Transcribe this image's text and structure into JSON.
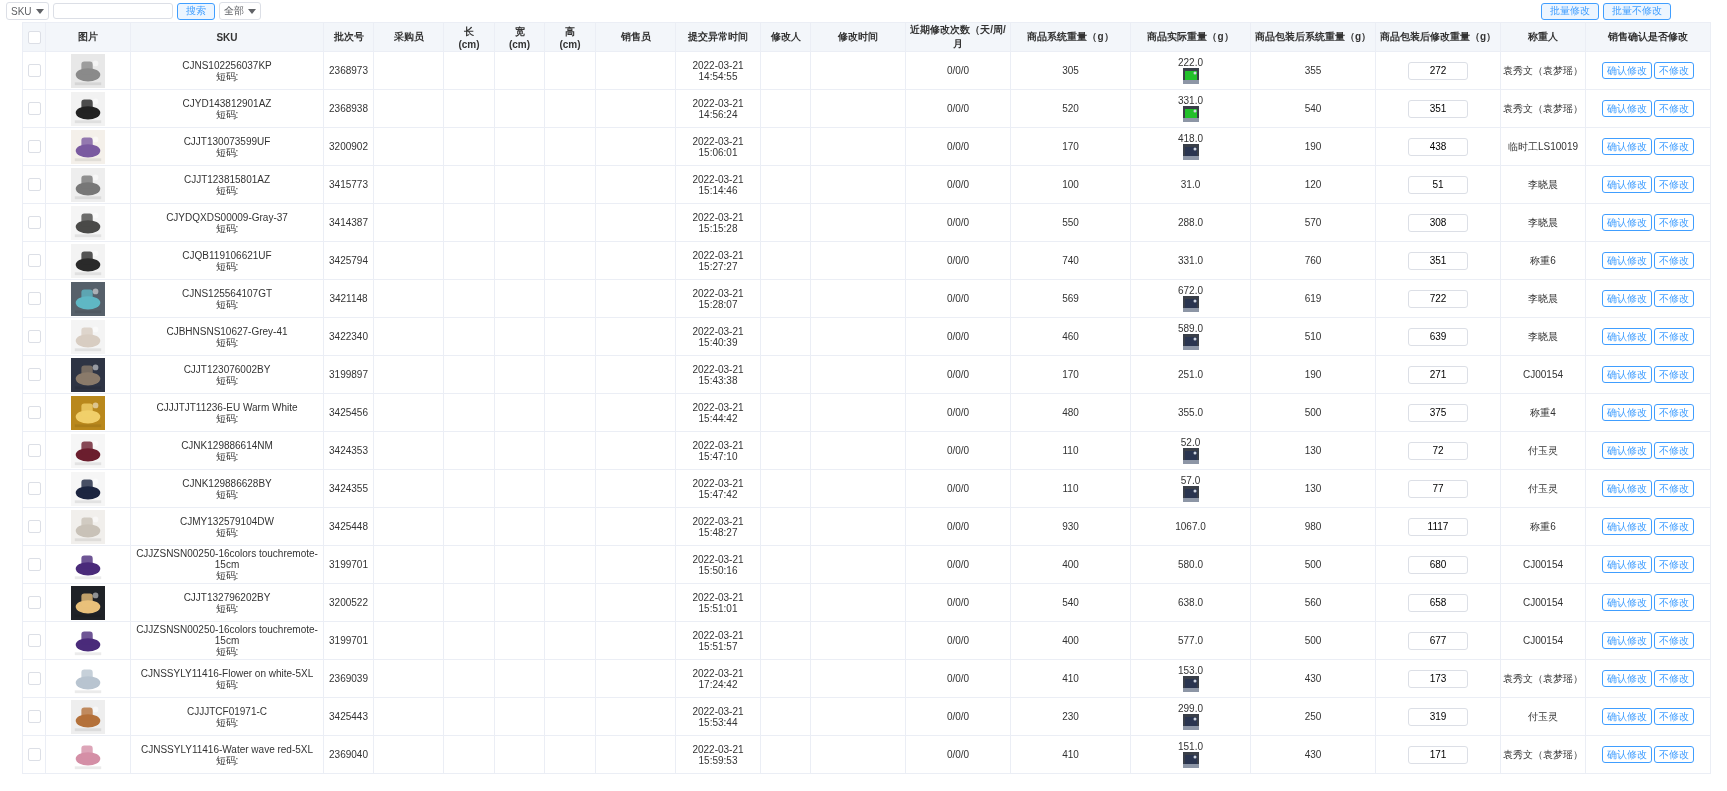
{
  "toolbar": {
    "field_select": "SKU",
    "search_button": "搜索",
    "status_select": "全部",
    "batch_buttons": [
      "批量修改",
      "批量不修改"
    ]
  },
  "table": {
    "select_all": {
      "checked": false
    },
    "columns": [
      "图片",
      "SKU",
      "批次号",
      "采购员",
      "长\n(cm)",
      "宽\n(cm)",
      "高\n(cm)",
      "销售员",
      "提交异常时间",
      "修改人",
      "修改时间",
      "近期修改次数（天/周/月",
      "商品系统重量（g）",
      "商品实际重量（g）",
      "商品包装后系统重量（g）",
      "商品包装后修改重量（g）",
      "称重人",
      "销售确认是否修改"
    ],
    "rows": [
      {
        "checked": false,
        "sku": "CJNS102256037KP",
        "short_code": "短码:",
        "batch": "2368973",
        "date": "2022-03-21",
        "time": "14:54:55",
        "count": "0/0/0",
        "sys_weight": "305",
        "actual_weight": "222.0",
        "pack_weight": "355",
        "edit_weight": "272",
        "weigher": "袁秀文（袁梦瑶）",
        "actions": [
          "确认修改",
          "不修改"
        ]
      },
      {
        "checked": false,
        "sku": "CJYD143812901AZ",
        "short_code": "短码:",
        "batch": "2368938",
        "date": "2022-03-21",
        "time": "14:56:24",
        "count": "0/0/0",
        "sys_weight": "520",
        "actual_weight": "331.0",
        "pack_weight": "540",
        "edit_weight": "351",
        "weigher": "袁秀文（袁梦瑶）",
        "actions": [
          "确认修改",
          "不修改"
        ]
      },
      {
        "checked": false,
        "sku": "CJJT130073599UF",
        "short_code": "短码:",
        "batch": "3200902",
        "date": "2022-03-21",
        "time": "15:06:01",
        "count": "0/0/0",
        "sys_weight": "170",
        "actual_weight": "418.0",
        "pack_weight": "190",
        "edit_weight": "438",
        "weigher": "临时工LS10019",
        "actions": [
          "确认修改",
          "不修改"
        ]
      },
      {
        "checked": false,
        "sku": "CJJT123815801AZ",
        "short_code": "短码:",
        "batch": "3415773",
        "date": "2022-03-21",
        "time": "15:14:46",
        "count": "0/0/0",
        "sys_weight": "100",
        "actual_weight": "31.0",
        "pack_weight": "120",
        "edit_weight": "51",
        "weigher": "李晓晨",
        "actions": [
          "确认修改",
          "不修改"
        ]
      },
      {
        "checked": false,
        "sku": "CJYDQXDS00009-Gray-37",
        "short_code": "短码:",
        "batch": "3414387",
        "date": "2022-03-21",
        "time": "15:15:28",
        "count": "0/0/0",
        "sys_weight": "550",
        "actual_weight": "288.0",
        "pack_weight": "570",
        "edit_weight": "308",
        "weigher": "李晓晨",
        "actions": [
          "确认修改",
          "不修改"
        ]
      },
      {
        "checked": false,
        "sku": "CJQB119106621UF",
        "short_code": "短码:",
        "batch": "3425794",
        "date": "2022-03-21",
        "time": "15:27:27",
        "count": "0/0/0",
        "sys_weight": "740",
        "actual_weight": "331.0",
        "pack_weight": "760",
        "edit_weight": "351",
        "weigher": "称重6",
        "actions": [
          "确认修改",
          "不修改"
        ]
      },
      {
        "checked": false,
        "sku": "CJNS125564107GT",
        "short_code": "短码:",
        "batch": "3421148",
        "date": "2022-03-21",
        "time": "15:28:07",
        "count": "0/0/0",
        "sys_weight": "569",
        "actual_weight": "672.0",
        "pack_weight": "619",
        "edit_weight": "722",
        "weigher": "李晓晨",
        "actions": [
          "确认修改",
          "不修改"
        ]
      },
      {
        "checked": false,
        "sku": "CJBHNSNS10627-Grey-41",
        "short_code": "短码:",
        "batch": "3422340",
        "date": "2022-03-21",
        "time": "15:40:39",
        "count": "0/0/0",
        "sys_weight": "460",
        "actual_weight": "589.0",
        "pack_weight": "510",
        "edit_weight": "639",
        "weigher": "李晓晨",
        "actions": [
          "确认修改",
          "不修改"
        ]
      },
      {
        "checked": false,
        "sku": "CJJT123076002BY",
        "short_code": "短码:",
        "batch": "3199897",
        "date": "2022-03-21",
        "time": "15:43:38",
        "count": "0/0/0",
        "sys_weight": "170",
        "actual_weight": "251.0",
        "pack_weight": "190",
        "edit_weight": "271",
        "weigher": "CJ00154",
        "actions": [
          "确认修改",
          "不修改"
        ]
      },
      {
        "checked": false,
        "sku": "CJJJTJT11236-EU Warm White",
        "short_code": "短码:",
        "batch": "3425456",
        "date": "2022-03-21",
        "time": "15:44:42",
        "count": "0/0/0",
        "sys_weight": "480",
        "actual_weight": "355.0",
        "pack_weight": "500",
        "edit_weight": "375",
        "weigher": "称重4",
        "actions": [
          "确认修改",
          "不修改"
        ]
      },
      {
        "checked": false,
        "sku": "CJNK129886614NM",
        "short_code": "短码:",
        "batch": "3424353",
        "date": "2022-03-21",
        "time": "15:47:10",
        "count": "0/0/0",
        "sys_weight": "110",
        "actual_weight": "52.0",
        "pack_weight": "130",
        "edit_weight": "72",
        "weigher": "付玉灵",
        "actions": [
          "确认修改",
          "不修改"
        ]
      },
      {
        "checked": false,
        "sku": "CJNK129886628BY",
        "short_code": "短码:",
        "batch": "3424355",
        "date": "2022-03-21",
        "time": "15:47:42",
        "count": "0/0/0",
        "sys_weight": "110",
        "actual_weight": "57.0",
        "pack_weight": "130",
        "edit_weight": "77",
        "weigher": "付玉灵",
        "actions": [
          "确认修改",
          "不修改"
        ]
      },
      {
        "checked": false,
        "sku": "CJMY132579104DW",
        "short_code": "短码:",
        "batch": "3425448",
        "date": "2022-03-21",
        "time": "15:48:27",
        "count": "0/0/0",
        "sys_weight": "930",
        "actual_weight": "1067.0",
        "pack_weight": "980",
        "edit_weight": "1117",
        "weigher": "称重6",
        "actions": [
          "确认修改",
          "不修改"
        ]
      },
      {
        "checked": false,
        "sku": "CJJZSNSN00250-16colors touchremote-15cm",
        "short_code": "短码:",
        "batch": "3199701",
        "date": "2022-03-21",
        "time": "15:50:16",
        "count": "0/0/0",
        "sys_weight": "400",
        "actual_weight": "580.0",
        "pack_weight": "500",
        "edit_weight": "680",
        "weigher": "CJ00154",
        "actions": [
          "确认修改",
          "不修改"
        ]
      },
      {
        "checked": false,
        "sku": "CJJT132796202BY",
        "short_code": "短码:",
        "batch": "3200522",
        "date": "2022-03-21",
        "time": "15:51:01",
        "count": "0/0/0",
        "sys_weight": "540",
        "actual_weight": "638.0",
        "pack_weight": "560",
        "edit_weight": "658",
        "weigher": "CJ00154",
        "actions": [
          "确认修改",
          "不修改"
        ]
      },
      {
        "checked": false,
        "sku": "CJJZSNSN00250-16colors touchremote-15cm",
        "short_code": "短码:",
        "batch": "3199701",
        "date": "2022-03-21",
        "time": "15:51:57",
        "count": "0/0/0",
        "sys_weight": "400",
        "actual_weight": "577.0",
        "pack_weight": "500",
        "edit_weight": "677",
        "weigher": "CJ00154",
        "actions": [
          "确认修改",
          "不修改"
        ]
      },
      {
        "checked": false,
        "sku": "CJNSSYLY11416-Flower on white-5XL",
        "short_code": "短码:",
        "batch": "2369039",
        "date": "2022-03-21",
        "time": "17:24:42",
        "count": "0/0/0",
        "sys_weight": "410",
        "actual_weight": "153.0",
        "pack_weight": "430",
        "edit_weight": "173",
        "weigher": "袁秀文（袁梦瑶）",
        "actions": [
          "确认修改",
          "不修改"
        ]
      },
      {
        "checked": false,
        "sku": "CJJJTCF01971-C",
        "short_code": "短码:",
        "batch": "3425443",
        "date": "2022-03-21",
        "time": "15:53:44",
        "count": "0/0/0",
        "sys_weight": "230",
        "actual_weight": "299.0",
        "pack_weight": "250",
        "edit_weight": "319",
        "weigher": "付玉灵",
        "actions": [
          "确认修改",
          "不修改"
        ]
      },
      {
        "checked": false,
        "sku": "CJNSSYLY11416-Water wave red-5XL",
        "short_code": "短码:",
        "batch": "2369040",
        "date": "2022-03-21",
        "time": "15:59:53",
        "count": "0/0/0",
        "sys_weight": "410",
        "actual_weight": "151.0",
        "pack_weight": "430",
        "edit_weight": "171",
        "weigher": "袁秀文（袁梦瑶）",
        "actions": [
          "确认修改",
          "不修改"
        ]
      }
    ]
  }
}
